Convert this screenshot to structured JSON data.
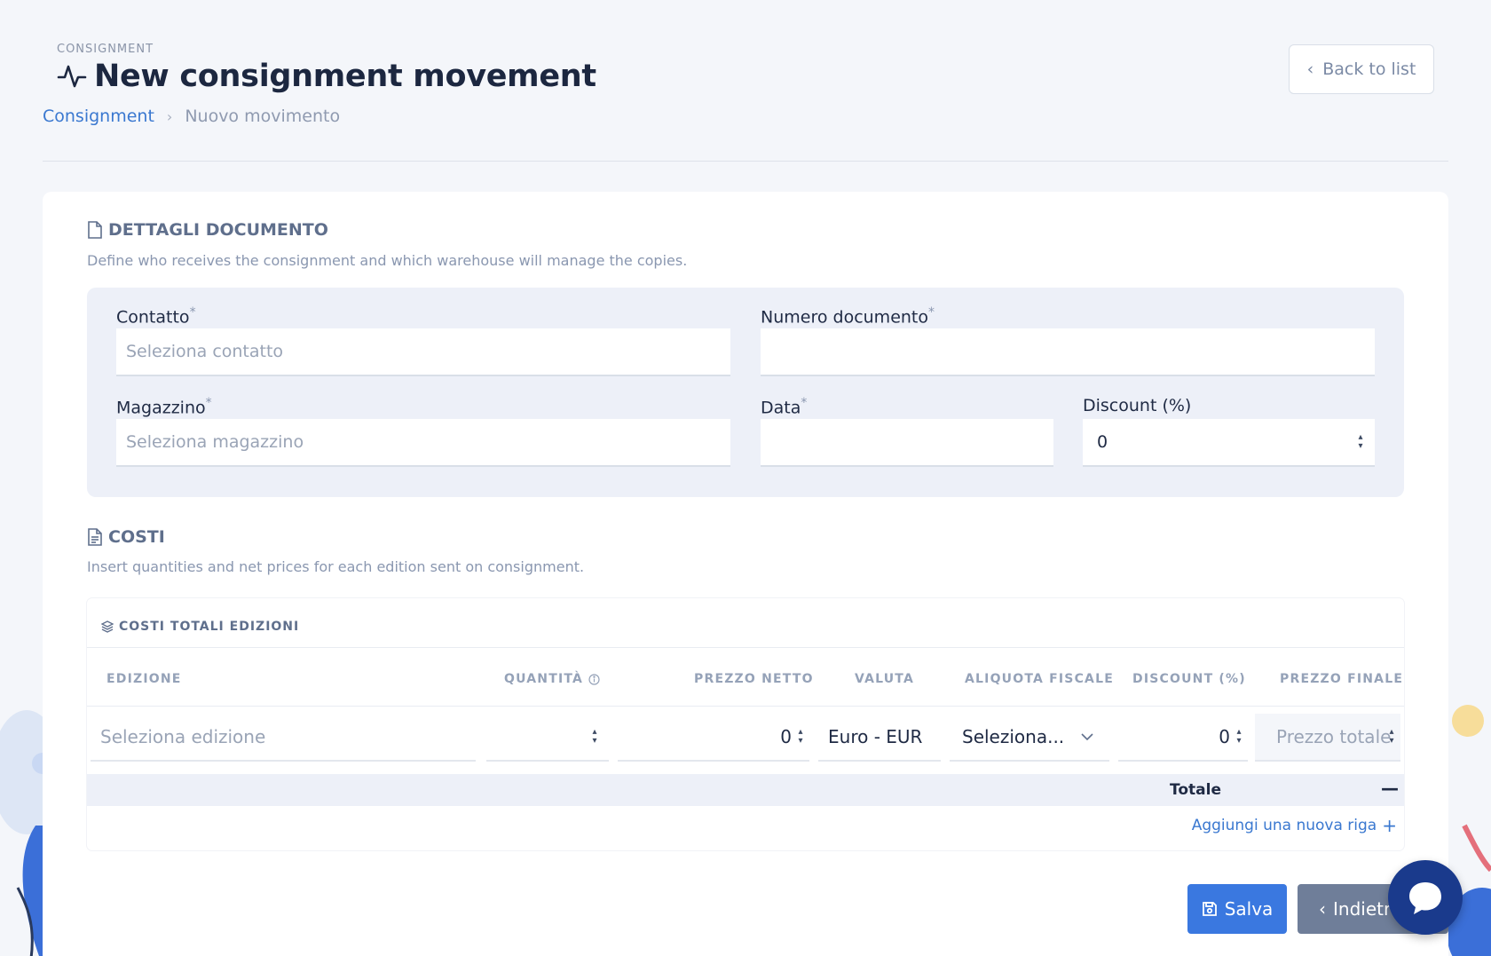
{
  "header": {
    "eyebrow": "CONSIGNMENT",
    "title": "New consignment movement",
    "breadcrumb": {
      "root": "Consignment",
      "current": "Nuovo movimento"
    },
    "back_label": "Back to list"
  },
  "section_details": {
    "title": "DETTAGLI DOCUMENTO",
    "description": "Define who receives the consignment and which warehouse will manage the copies."
  },
  "form": {
    "contatto": {
      "label": "Contatto",
      "required": "*",
      "placeholder": "Seleziona contatto"
    },
    "numero": {
      "label": "Numero documento",
      "required": "*",
      "value": ""
    },
    "magazzino": {
      "label": "Magazzino",
      "required": "*",
      "placeholder": "Seleziona magazzino"
    },
    "data": {
      "label": "Data",
      "required": "*",
      "value": ""
    },
    "discount": {
      "label": "Discount (%)",
      "value": "0"
    }
  },
  "section_costs": {
    "title": "COSTI",
    "description": "Insert quantities and net prices for each edition sent on consignment."
  },
  "table": {
    "title": "COSTI TOTALI EDIZIONI",
    "headers": {
      "edizione": "EDIZIONE",
      "quantita": "QUANTITÀ",
      "prezzo_netto": "PREZZO NETTO",
      "valuta": "VALUTA",
      "aliquota": "ALIQUOTA FISCALE",
      "discount": "DISCOUNT (%)",
      "prezzo_finale": "PREZZO FINALE"
    },
    "row": {
      "edizione_placeholder": "Seleziona edizione",
      "quantita": "",
      "prezzo_netto": "0",
      "valuta": "Euro - EUR",
      "aliquota": "Seleziona...",
      "discount": "0",
      "prezzo_finale_placeholder": "Prezzo totale"
    },
    "total_label": "Totale",
    "total_value": "—",
    "add_row": "Aggiungi una nuova riga"
  },
  "actions": {
    "save": "Salva",
    "back": "Indietro"
  },
  "colors": {
    "accent": "#3a78e0",
    "secondary": "#6f7e99",
    "chat": "#1a3a8c"
  },
  "icons": {
    "title": "activity-icon",
    "back": "chevron-left-icon",
    "details": "file-icon",
    "costs": "file-text-icon",
    "table": "layers-icon",
    "info": "info-icon",
    "save": "save-icon",
    "chat": "chat-icon"
  }
}
